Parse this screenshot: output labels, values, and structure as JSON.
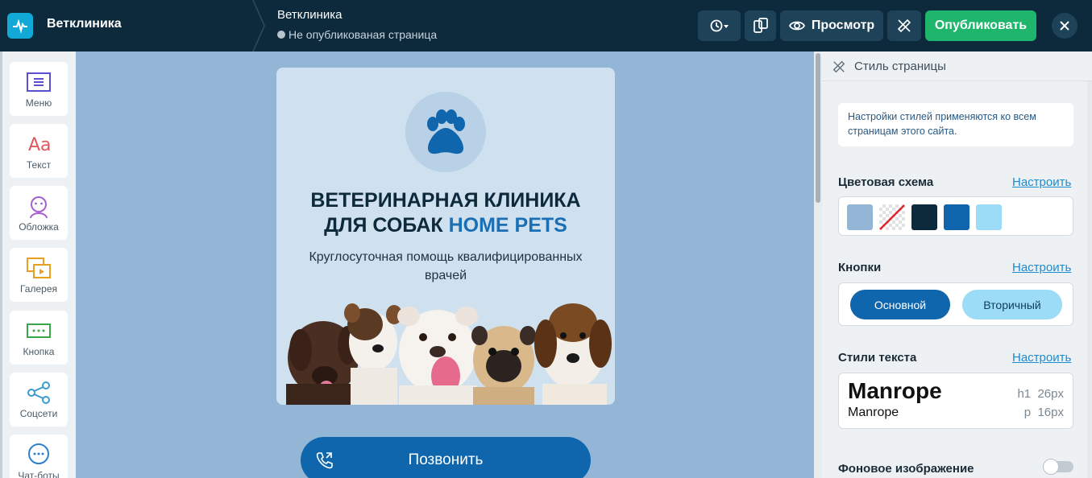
{
  "topbar": {
    "site_name": "Ветклиника",
    "page_name": "Ветклиника",
    "page_status": "Не опубликованая страница",
    "preview_label": "Просмотр",
    "publish_label": "Опубликовать"
  },
  "tools": [
    {
      "label": "Меню",
      "icon": "menu-icon"
    },
    {
      "label": "Текст",
      "icon": "text-icon"
    },
    {
      "label": "Обложка",
      "icon": "cover-icon"
    },
    {
      "label": "Галерея",
      "icon": "gallery-icon"
    },
    {
      "label": "Кнопка",
      "icon": "button-icon"
    },
    {
      "label": "Соцсети",
      "icon": "share-icon"
    },
    {
      "label": "Чат-боты",
      "icon": "chat-icon"
    }
  ],
  "card": {
    "title_line1": "ВЕТЕРИНАРНАЯ КЛИНИКА",
    "title_line2_prefix": "ДЛЯ СОБАК ",
    "title_line2_accent": "HOME PETS",
    "subtitle": "Круглосуточная помощь квалифицированных врачей",
    "call_label": "Позвонить"
  },
  "panel": {
    "header": "Стиль страницы",
    "info": "Настройки стилей применяются ко всем страницам этого сайта.",
    "color_scheme_title": "Цветовая схема",
    "buttons_title": "Кнопки",
    "text_styles_title": "Стили текста",
    "bg_image_title": "Фоновое изображение",
    "configure_label": "Настроить",
    "primary_btn": "Основной",
    "secondary_btn": "Вторичный",
    "font_name": "Manrope",
    "h1_tag": "h1",
    "h1_size": "26px",
    "p_tag": "p",
    "p_size": "16px",
    "bg_image_enabled": false
  },
  "colors": {
    "swatches": [
      "#93b6d6",
      "transparent",
      "#0d2a3d",
      "#0f66ad",
      "#9ddcf6"
    ],
    "publish": "#1fb56d",
    "accent": "#1a6fb5"
  }
}
